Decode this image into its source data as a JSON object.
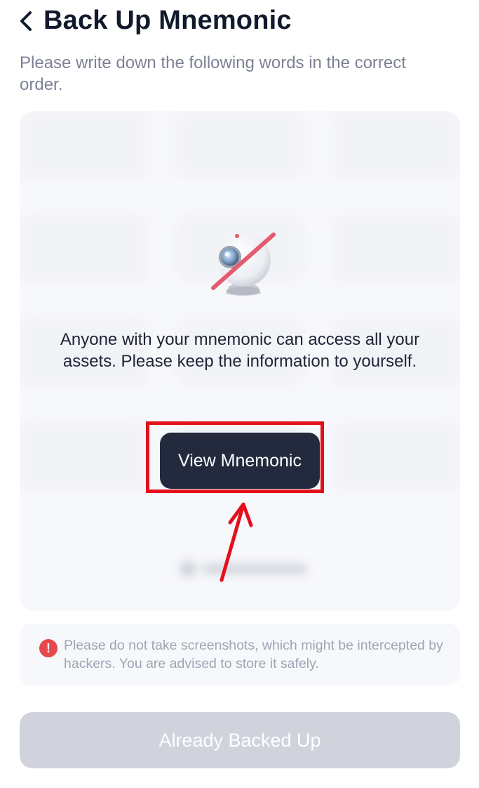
{
  "header": {
    "back_icon": "chevron-left-icon",
    "title": "Back Up Mnemonic"
  },
  "subtitle": "Please write down the following words in the correct order.",
  "mnemonic_panel": {
    "blurred": true,
    "privacy_icon": "camera-off-icon",
    "warning": "Anyone with your mnemonic can access all your assets. Please keep the information to yourself.",
    "view_button_label": "View Mnemonic"
  },
  "notice": {
    "icon": "exclamation-icon",
    "text": "Please do not take screenshots, which might be intercepted by hackers. You are advised to store it safely."
  },
  "footer": {
    "backed_up_label": "Already Backed Up"
  },
  "colors": {
    "primary_button": "#232a3e",
    "disabled_button": "#d1d3dc",
    "highlight_box": "#e3101c",
    "annotation_arrow": "#e3101c",
    "warning_icon": "#e5484d"
  }
}
